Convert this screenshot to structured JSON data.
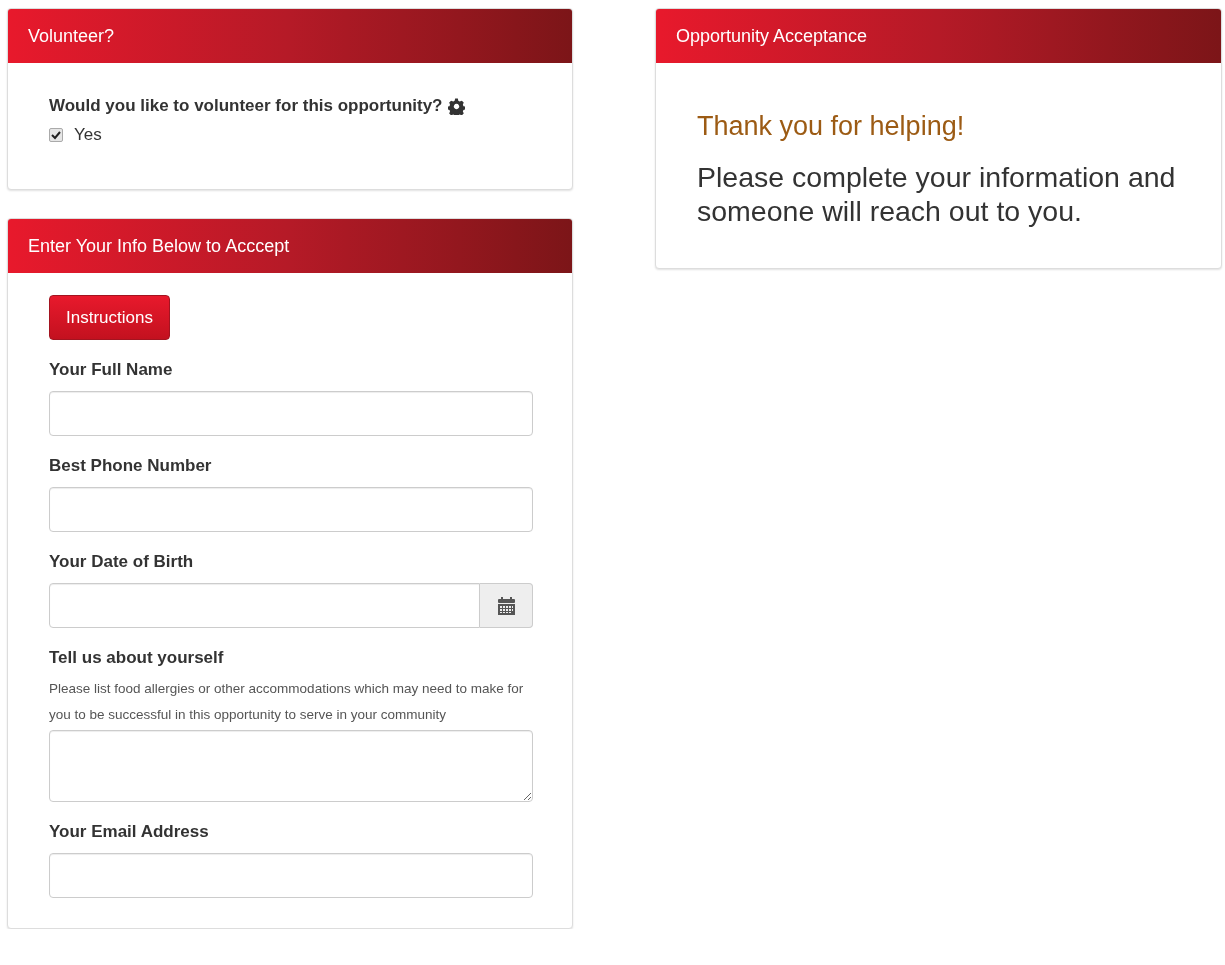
{
  "volunteer_panel": {
    "title": "Volunteer?",
    "question": "Would you like to volunteer for this opportunity?",
    "options": [
      {
        "label": "Yes",
        "checked": true
      }
    ]
  },
  "info_panel": {
    "title": "Enter Your Info Below to Acccept",
    "instructions_button": "Instructions",
    "fields": [
      {
        "kind": "text",
        "label": "Your Full Name"
      },
      {
        "kind": "text",
        "label": "Best Phone Number"
      },
      {
        "kind": "date",
        "label": "Your Date of Birth"
      },
      {
        "kind": "textarea",
        "label": "Tell us about yourself",
        "help": " Please list food allergies or other accommodations which may need to make for you to be successful in this opportunity to serve in your community"
      },
      {
        "kind": "text",
        "label": "Your Email Address"
      }
    ]
  },
  "acceptance_panel": {
    "title": "Opportunity Acceptance",
    "heading": "Thank you for helping!",
    "message": "Please complete your information and someone will reach out to you."
  }
}
